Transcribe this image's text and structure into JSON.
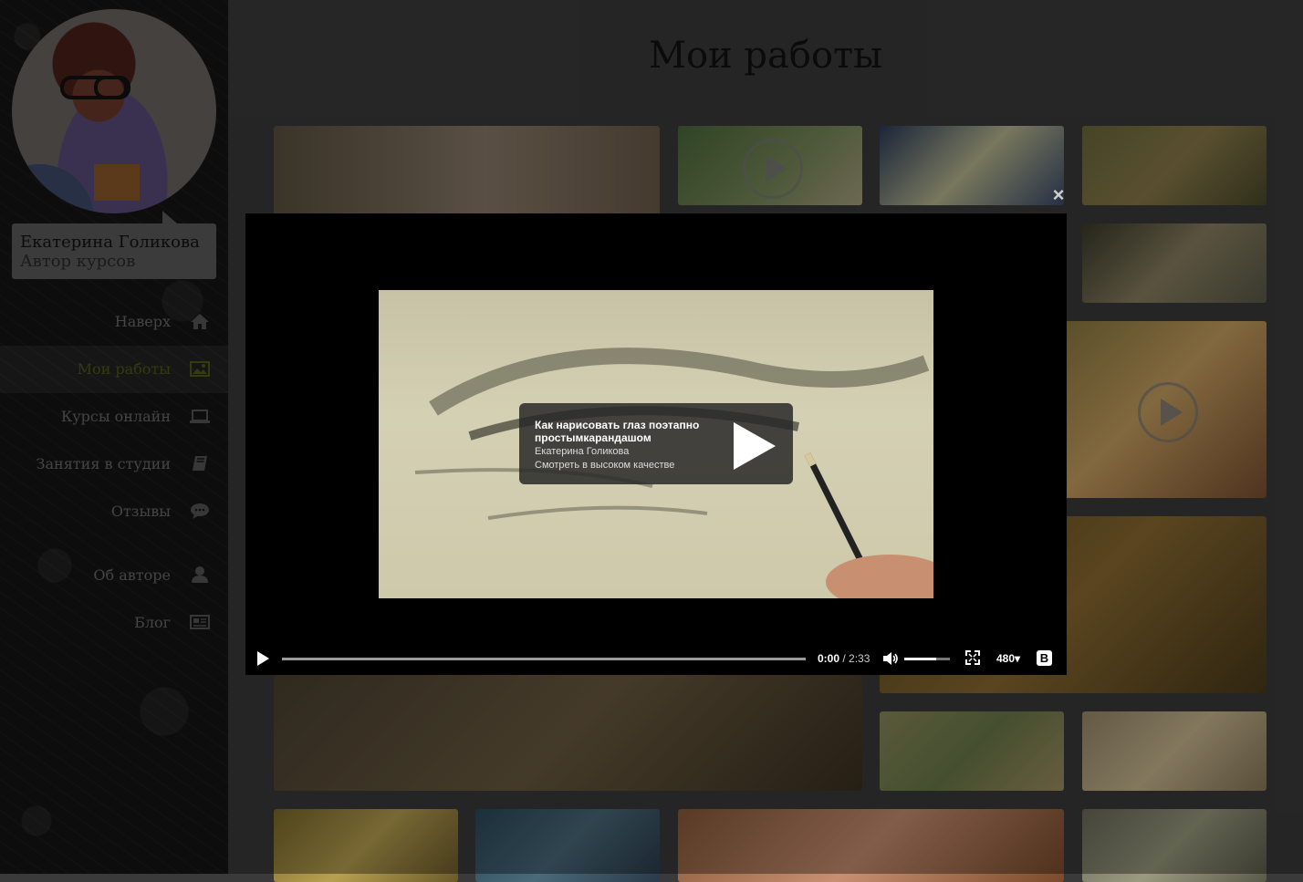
{
  "sidebar": {
    "profile": {
      "name": "Екатерина Голикова",
      "role": "Автор курсов"
    },
    "nav": [
      {
        "label": "Наверх",
        "icon": "home-icon"
      },
      {
        "label": "Мои работы",
        "icon": "picture-icon",
        "active": true
      },
      {
        "label": "Курсы онлайн",
        "icon": "laptop-icon"
      },
      {
        "label": "Занятия в студии",
        "icon": "book-icon"
      },
      {
        "label": "Отзывы",
        "icon": "chat-icon"
      },
      {
        "label": "Об авторе",
        "icon": "user-icon"
      },
      {
        "label": "Блог",
        "icon": "newspaper-icon"
      }
    ]
  },
  "main": {
    "title": "Мои работы"
  },
  "modal": {
    "close": "×",
    "video": {
      "title": "Как нарисовать глаз поэтапно простымкарандашом",
      "author": "Екатерина Голикова",
      "hq_link": "Смотреть в высоком качестве",
      "current_time": "0:00",
      "duration": "/ 2:33",
      "quality": "480",
      "volume": 0.7,
      "progress": 0,
      "brand": "В"
    }
  },
  "colors": {
    "active_nav": "#4f5d10",
    "overlay": "#000000"
  }
}
